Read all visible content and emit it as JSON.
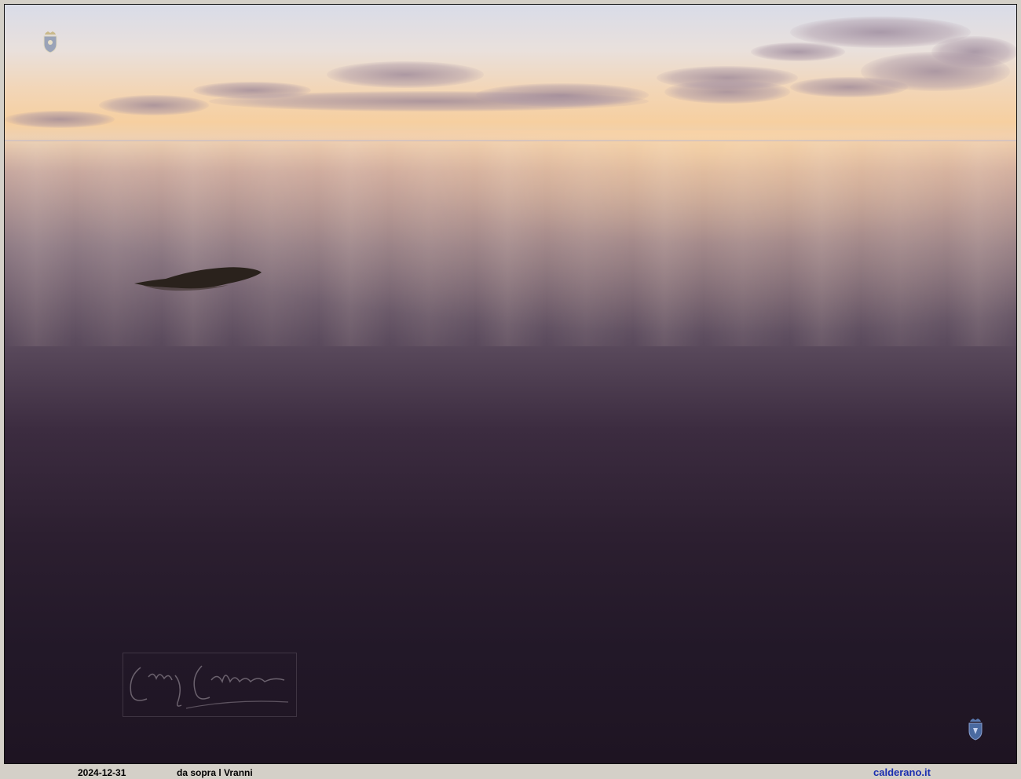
{
  "caption": {
    "date": "2024-12-31",
    "title": "da sopra l Vranni",
    "site": "calderano.it"
  },
  "icons": {
    "top_left": "coat-of-arms-icon",
    "bottom_right": "coat-of-arms-icon"
  },
  "colors": {
    "frame": "#d4d0c8",
    "site_link": "#1a2fb0",
    "sky_top": "#d9dce8",
    "horizon": "#f6cfa0",
    "sea_dark": "#1e1422"
  }
}
